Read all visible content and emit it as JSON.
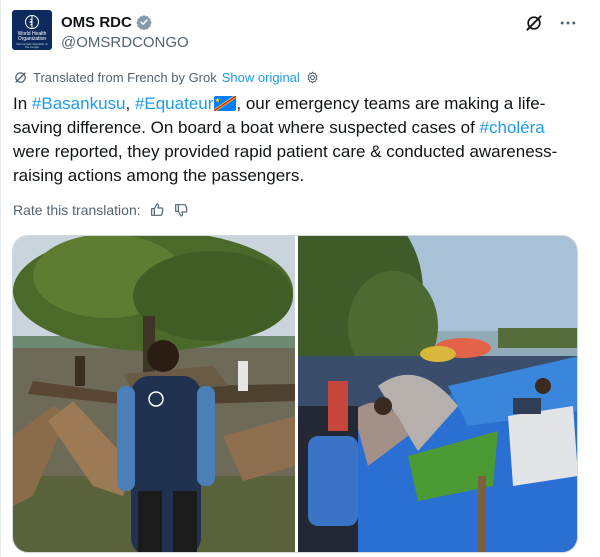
{
  "account": {
    "display_name": "OMS RDC",
    "handle": "@OMSRDCONGO",
    "verified": true,
    "avatar_line1": "World Health Organization",
    "avatar_line2": "Democratic Republic of the Congo"
  },
  "translation": {
    "text": "Translated from French by Grok",
    "show_original": "Show original"
  },
  "post": {
    "prefix": "In ",
    "tag1": "#Basankusu",
    "sep1": ", ",
    "tag2": "#Equateur",
    "mid": ", our emergency teams are making a life-saving difference. On board a boat where suspected cases of ",
    "tag3": "#choléra",
    "suffix": " were reported, they provided rapid patient care & conducted awareness-raising actions among the passengers."
  },
  "rate": {
    "label": "Rate this translation:"
  },
  "icons": {
    "verified": "verified-badge-icon",
    "grok": "grok-icon",
    "more": "more-options-icon",
    "translate": "translate-icon",
    "settings": "settings-gear-icon",
    "thumbs_up": "thumbs-up-icon",
    "thumbs_down": "thumbs-down-icon"
  },
  "colors": {
    "link": "#1d9bf0",
    "muted": "#536471",
    "text": "#0f1419",
    "avatar_bg": "#0d2a5c"
  }
}
